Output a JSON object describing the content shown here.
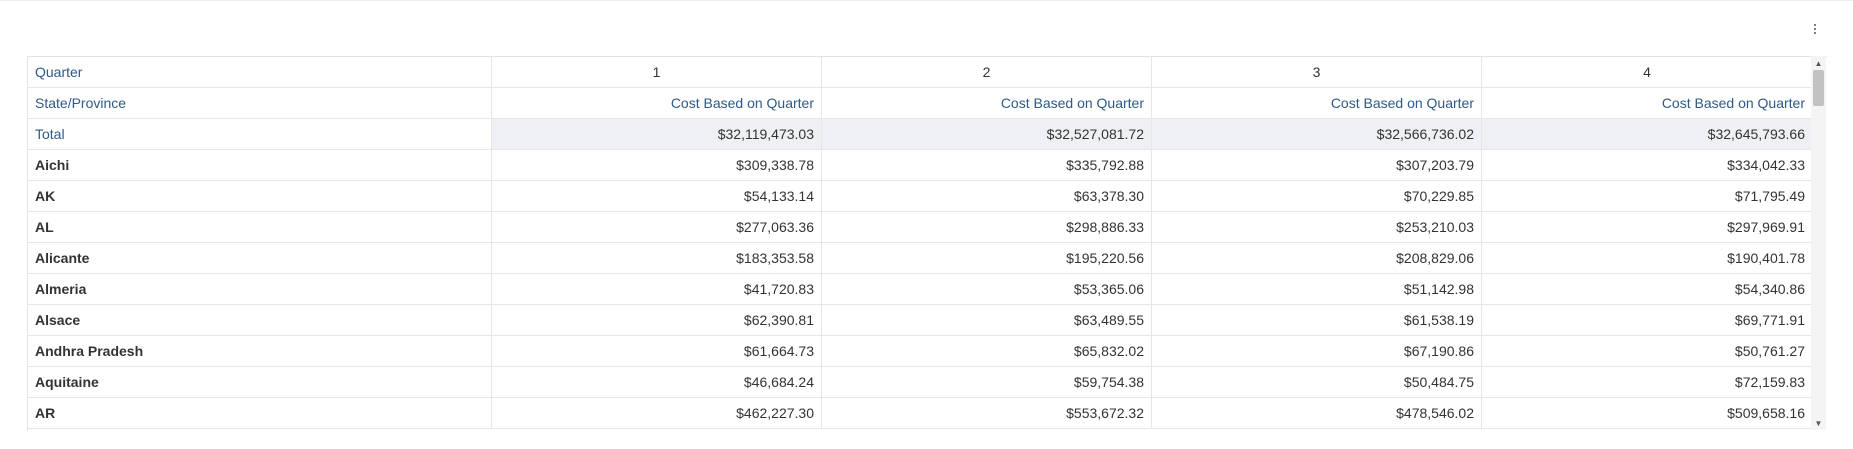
{
  "menu_icon": "more-vertical-icon",
  "table": {
    "column_dimension_label": "Quarter",
    "row_dimension_label": "State/Province",
    "quarters": [
      "1",
      "2",
      "3",
      "4"
    ],
    "measure_label": "Cost Based on Quarter",
    "total": {
      "label": "Total",
      "values": [
        "$32,119,473.03",
        "$32,527,081.72",
        "$32,566,736.02",
        "$32,645,793.66"
      ]
    },
    "rows": [
      {
        "state": "Aichi",
        "values": [
          "$309,338.78",
          "$335,792.88",
          "$307,203.79",
          "$334,042.33"
        ]
      },
      {
        "state": "AK",
        "values": [
          "$54,133.14",
          "$63,378.30",
          "$70,229.85",
          "$71,795.49"
        ]
      },
      {
        "state": "AL",
        "values": [
          "$277,063.36",
          "$298,886.33",
          "$253,210.03",
          "$297,969.91"
        ]
      },
      {
        "state": "Alicante",
        "values": [
          "$183,353.58",
          "$195,220.56",
          "$208,829.06",
          "$190,401.78"
        ]
      },
      {
        "state": "Almeria",
        "values": [
          "$41,720.83",
          "$53,365.06",
          "$51,142.98",
          "$54,340.86"
        ]
      },
      {
        "state": "Alsace",
        "values": [
          "$62,390.81",
          "$63,489.55",
          "$61,538.19",
          "$69,771.91"
        ]
      },
      {
        "state": "Andhra Pradesh",
        "values": [
          "$61,664.73",
          "$65,832.02",
          "$67,190.86",
          "$50,761.27"
        ]
      },
      {
        "state": "Aquitaine",
        "values": [
          "$46,684.24",
          "$59,754.38",
          "$50,484.75",
          "$72,159.83"
        ]
      },
      {
        "state": "AR",
        "values": [
          "$462,227.30",
          "$553,672.32",
          "$478,546.02",
          "$509,658.16"
        ]
      }
    ]
  },
  "scrollbar": {
    "up_icon": "▲",
    "down_icon": "▼"
  }
}
